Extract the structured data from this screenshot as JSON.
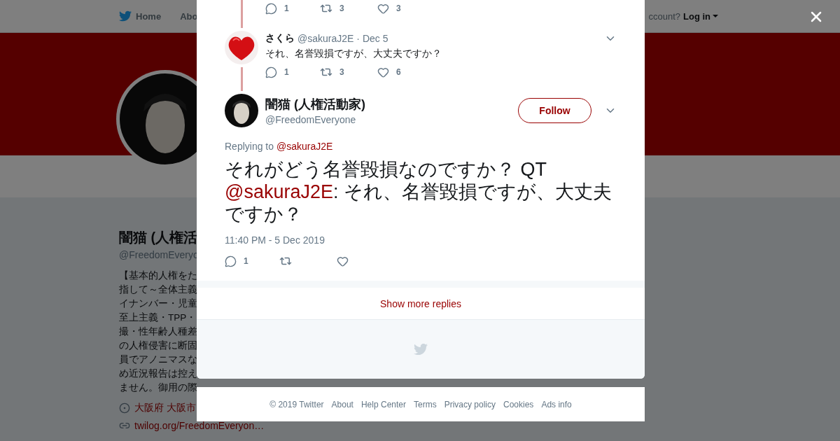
{
  "nav": {
    "items": [
      "Home",
      "Abo"
    ],
    "login_prompt": "ccount?",
    "login": "Log in"
  },
  "profile": {
    "name": "闇猫 (人権活",
    "handle": "@FreedomEveryo",
    "bio": [
      "【基本的人権をた",
      "指して～全体主義",
      "イナンバー・児童",
      "至上主義・TPP・",
      "撮・性年齢人種差",
      "の人権侵害に断固",
      "員でアノニマスな",
      "め近況報告は控え",
      "ません。御用の際"
    ],
    "location": "大阪府 大阪市",
    "url": "twilog.org/FreedomEveryon…"
  },
  "modal": {
    "previous_actions": {
      "replies": "1",
      "retweets": "3",
      "likes": "3"
    },
    "reply": {
      "name": "さくら",
      "handle": "@sakuraJ2E",
      "date": "· Dec 5",
      "text": "それ、名誉毀損ですが、大丈夫ですか？",
      "replies": "1",
      "retweets": "3",
      "likes": "6"
    },
    "tweet": {
      "name": "闇猫 (人権活動家)",
      "handle": "@FreedomEveryone",
      "follow": "Follow",
      "replying_to_label": "Replying to",
      "replying_to": "@sakuraJ2E",
      "text_before": "それがどう名誉毀損なのですか？ QT ",
      "mention": "@sakuraJ2E",
      "text_after": ": それ、名誉毀損ですが、大丈夫ですか？",
      "timestamp": "11:40 PM - 5 Dec 2019",
      "replies": "1"
    },
    "show_more": "Show more replies"
  },
  "footer": [
    "© 2019 Twitter",
    "About",
    "Help Center",
    "Terms",
    "Privacy policy",
    "Cookies",
    "Ads info"
  ]
}
